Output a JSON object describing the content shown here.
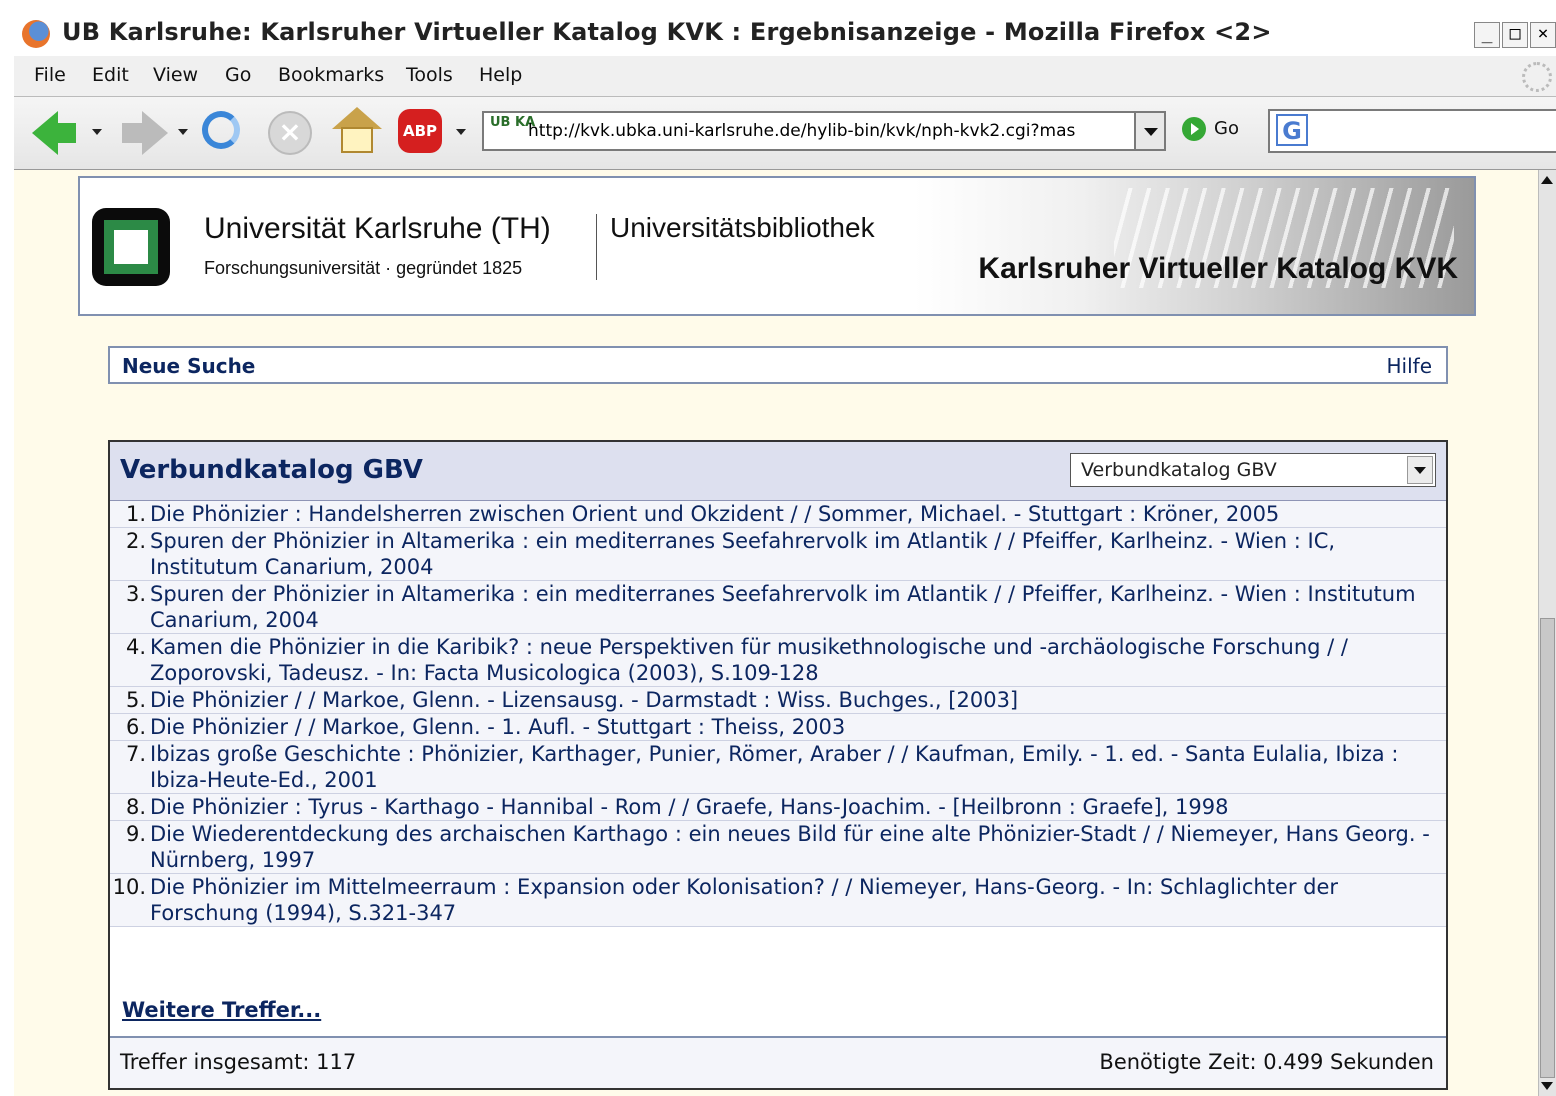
{
  "window": {
    "title": "UB Karlsruhe: Karlsruher Virtueller Katalog KVK : Ergebnisanzeige - Mozilla Firefox <2>",
    "controls": [
      "_",
      "□",
      "×"
    ]
  },
  "menu": [
    {
      "label": "File",
      "accel": "F"
    },
    {
      "label": "Edit",
      "accel": "E"
    },
    {
      "label": "View",
      "accel": "V"
    },
    {
      "label": "Go",
      "accel": "G"
    },
    {
      "label": "Bookmarks",
      "accel": "B"
    },
    {
      "label": "Tools",
      "accel": "T"
    },
    {
      "label": "Help",
      "accel": "H"
    }
  ],
  "toolbar": {
    "url": "http://kvk.ubka.uni-karlsruhe.de/hylib-bin/kvk/nph-kvk2.cgi?mas",
    "site_icon_text": "UB KA",
    "go_label": "Go",
    "abp_label": "ABP",
    "search_engine_icon": "G"
  },
  "banner": {
    "university": "Universität Karlsruhe (TH)",
    "subtitle": "Forschungsuniversität · gegründet 1825",
    "library": "Universitätsbibliothek",
    "catalog": "Karlsruher Virtueller Katalog KVK"
  },
  "nav": {
    "new_search": "Neue Suche",
    "help": "Hilfe"
  },
  "results": {
    "catalog_title": "Verbundkatalog GBV",
    "catalog_select": "Verbundkatalog GBV",
    "items": [
      {
        "num": "1.",
        "text": "Die Phönizier : Handelsherren zwischen Orient und Okzident / / Sommer, Michael. - Stuttgart : Kröner, 2005"
      },
      {
        "num": "2.",
        "text": "Spuren der Phönizier in Altamerika : ein mediterranes Seefahrervolk im Atlantik / / Pfeiffer, Karlheinz. - Wien : IC, Institutum Canarium, 2004"
      },
      {
        "num": "3.",
        "text": "Spuren der Phönizier in Altamerika : ein mediterranes Seefahrervolk im Atlantik / / Pfeiffer, Karlheinz. - Wien : Institutum Canarium, 2004"
      },
      {
        "num": "4.",
        "text": "Kamen die Phönizier in die Karibik? : neue Perspektiven für musikethnologische und -archäologische Forschung / / Zoporovski, Tadeusz. - In: Facta Musicologica (2003), S.109-128"
      },
      {
        "num": "5.",
        "text": "Die Phönizier / / Markoe, Glenn. - Lizensausg. - Darmstadt : Wiss. Buchges., [2003]"
      },
      {
        "num": "6.",
        "text": "Die Phönizier / / Markoe, Glenn. - 1. Aufl. - Stuttgart : Theiss, 2003"
      },
      {
        "num": "7.",
        "text": "Ibizas große Geschichte : Phönizier, Karthager, Punier, Römer, Araber / / Kaufman, Emily. - 1. ed. - Santa Eulalia, Ibiza : Ibiza-Heute-Ed., 2001"
      },
      {
        "num": "8.",
        "text": "Die Phönizier : Tyrus - Karthago - Hannibal - Rom / / Graefe, Hans-Joachim. - [Heilbronn : Graefe], 1998"
      },
      {
        "num": "9.",
        "text": "Die Wiederentdeckung des archaischen Karthago : ein neues Bild für eine alte Phönizier-Stadt / / Niemeyer, Hans Georg. - Nürnberg, 1997"
      },
      {
        "num": "10.",
        "text": "Die Phönizier im Mittelmeerraum : Expansion oder Kolonisation? / / Niemeyer, Hans-Georg. - In: Schlaglichter der Forschung (1994), S.321-347"
      }
    ],
    "more": "Weitere Treffer...",
    "total": "Treffer insgesamt: 117",
    "time": "Benötigte Zeit: 0.499 Sekunden"
  }
}
